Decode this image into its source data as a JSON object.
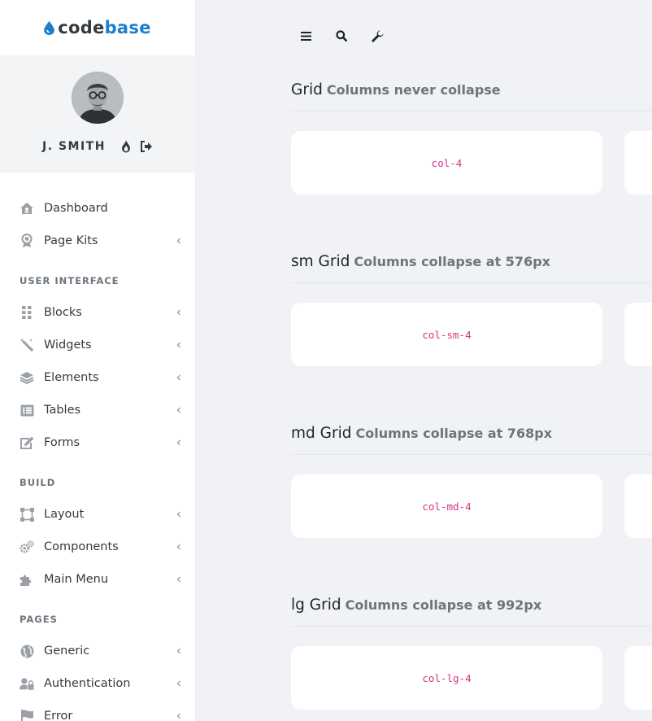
{
  "brand": {
    "part1": "code",
    "part2": "base",
    "accent": "#1b7fcc"
  },
  "user": {
    "name": "J. SMITH",
    "icons": [
      "fire-icon",
      "sign-out-icon"
    ]
  },
  "nav": {
    "items_top": [
      {
        "label": "Dashboard",
        "icon": "home-icon",
        "has_submenu": false
      },
      {
        "label": "Page Kits",
        "icon": "award-icon",
        "has_submenu": true
      }
    ],
    "heading_ui": "USER INTERFACE",
    "items_ui": [
      {
        "label": "Blocks",
        "icon": "grip-icon"
      },
      {
        "label": "Widgets",
        "icon": "magic-wand-icon"
      },
      {
        "label": "Elements",
        "icon": "layers-icon"
      },
      {
        "label": "Tables",
        "icon": "table-icon"
      },
      {
        "label": "Forms",
        "icon": "edit-icon"
      }
    ],
    "heading_build": "BUILD",
    "items_build": [
      {
        "label": "Layout",
        "icon": "vector-square-icon"
      },
      {
        "label": "Components",
        "icon": "cogs-icon"
      },
      {
        "label": "Main Menu",
        "icon": "puzzle-icon"
      }
    ],
    "heading_pages": "PAGES",
    "items_pages": [
      {
        "label": "Generic",
        "icon": "globe-icon"
      },
      {
        "label": "Authentication",
        "icon": "user-lock-icon"
      },
      {
        "label": "Error",
        "icon": "flag-icon"
      }
    ]
  },
  "toolbar": {
    "buttons": [
      "menu-icon",
      "search-icon",
      "wrench-icon"
    ]
  },
  "sections": [
    {
      "title": "Grid",
      "subtitle": "Columns never collapse",
      "card_label": "col-4"
    },
    {
      "title": "sm Grid",
      "subtitle": "Columns collapse at 576px",
      "card_label": "col-sm-4"
    },
    {
      "title": "md Grid",
      "subtitle": "Columns collapse at 768px",
      "card_label": "col-md-4"
    },
    {
      "title": "lg Grid",
      "subtitle": "Columns collapse at 992px",
      "card_label": "col-lg-4"
    }
  ]
}
